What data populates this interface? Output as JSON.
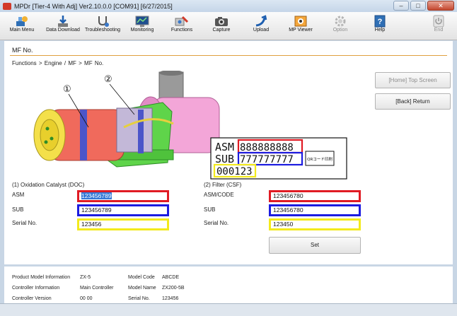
{
  "window": {
    "title": "MPDr [Tier-4 With Adj] Ver2.10.0.0 [COM91] [6/27/2015]",
    "controls": {
      "minimize": "–",
      "maximize": "□",
      "close": "✕"
    }
  },
  "toolbar": {
    "items": [
      {
        "label": "Main Menu",
        "icon": "main-menu-icon"
      },
      {
        "label": "Data Download",
        "icon": "data-download-icon"
      },
      {
        "label": "Troubleshooting",
        "icon": "stethoscope-icon"
      },
      {
        "label": "Monitoring",
        "icon": "monitoring-icon"
      },
      {
        "label": "Functions",
        "icon": "functions-icon"
      },
      {
        "label": "Capture",
        "icon": "camera-icon"
      },
      {
        "label": "Upload",
        "icon": "upload-icon"
      },
      {
        "label": "MP Viewer",
        "icon": "mp-viewer-icon"
      },
      {
        "label": "Option",
        "icon": "gear-icon",
        "disabled": true
      },
      {
        "label": "Help",
        "icon": "help-icon"
      },
      {
        "label": "End",
        "icon": "power-icon",
        "disabled": true
      }
    ]
  },
  "page": {
    "title": "MF No.",
    "breadcrumb": "Functions  >  Engine / MF  >  MF No."
  },
  "figure": {
    "callout_1": "①",
    "callout_2": "②",
    "label_asm": "ASM",
    "label_sub": "SUB",
    "asm_value": "888888888",
    "sub_value": "777777777",
    "serial_value": "000123",
    "qr_text": "QRコード印刷"
  },
  "side_buttons": {
    "home": "[Home] Top Screen",
    "back": "[Back] Return"
  },
  "doc": {
    "heading": "(1) Oxidation Catalyst (DOC)",
    "asm_label": "ASM",
    "asm_value": "123456789",
    "sub_label": "SUB",
    "sub_value": "123456789",
    "serial_label": "Serial No.",
    "serial_value": "123456"
  },
  "csf": {
    "heading": "(2) Filter (CSF)",
    "asm_label": "ASM/CODE",
    "asm_value": "123456780",
    "sub_label": "SUB",
    "sub_value": "123456780",
    "serial_label": "Serial No.",
    "serial_value": "123450"
  },
  "set_label": "Set",
  "info": {
    "product_model_label": "Product Model Information",
    "product_model_value": "ZX-5",
    "controller_info_label": "Controller Information",
    "controller_info_value": "Main Controller",
    "controller_version_label": "Controller Version",
    "controller_version_value": "00 00",
    "model_code_label": "Model Code",
    "model_code_value": "ABCDE",
    "model_name_label": "Model Name",
    "model_name_value": "ZX200-5B",
    "serial_label": "Serial No.",
    "serial_value": "123456"
  },
  "colors": {
    "red_border": "#e01b24",
    "blue_border": "#1c1ce0",
    "yellow_border": "#f3ea1c",
    "selection": "#3378d6",
    "accent_line": "#e0a040"
  }
}
